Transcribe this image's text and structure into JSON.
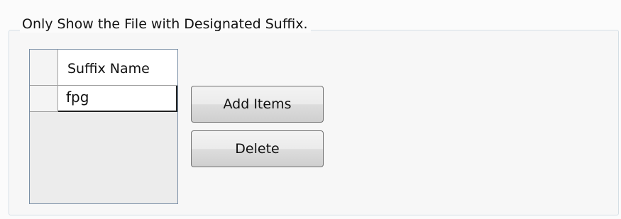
{
  "group": {
    "title": "Only Show the File with Designated Suffix."
  },
  "grid": {
    "columns": [
      "Suffix Name"
    ],
    "rows": [
      {
        "suffix": "fpg"
      }
    ]
  },
  "buttons": {
    "add_label": "Add Items",
    "delete_label": "Delete"
  }
}
